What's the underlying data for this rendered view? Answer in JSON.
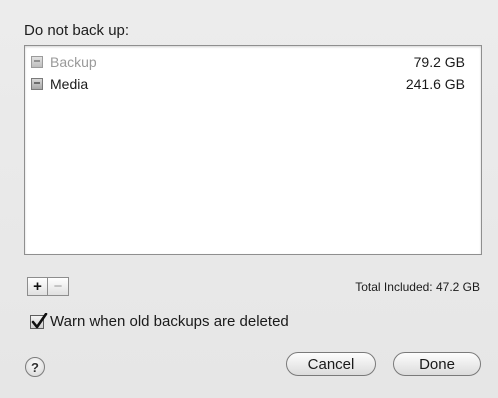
{
  "dialog": {
    "heading": "Do not back up:",
    "items": [
      {
        "name": "Backup",
        "size": "79.2 GB",
        "dimmed": true
      },
      {
        "name": "Media",
        "size": "241.6 GB",
        "dimmed": false
      }
    ],
    "add_symbol": "+",
    "remove_symbol": "−",
    "total_text": "Total Included: 47.2 GB",
    "warn_label": "Warn when old backups are deleted",
    "warn_checked": true,
    "help_symbol": "?",
    "cancel_label": "Cancel",
    "done_label": "Done"
  },
  "icons": {
    "item": "disk-icon",
    "help": "help-icon",
    "check": "checkmark-icon"
  }
}
